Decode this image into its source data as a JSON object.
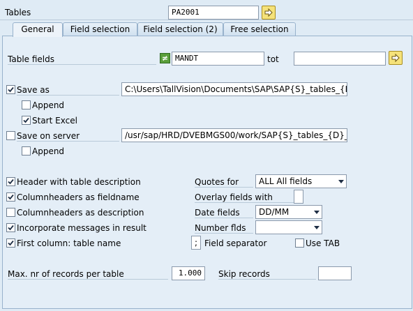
{
  "header": {
    "tables_label": "Tables",
    "tables_value": "PA2001"
  },
  "tabs": [
    {
      "label": "General"
    },
    {
      "label": "Field selection"
    },
    {
      "label": "Field selection (2)"
    },
    {
      "label": "Free selection"
    }
  ],
  "active_tab": "General",
  "general": {
    "table_fields_label": "Table fields",
    "table_fields_value": "MANDT",
    "tot_label": "tot",
    "tot_value": "",
    "save_as": {
      "label": "Save as",
      "checked": true,
      "path": "C:\\Users\\TallVision\\Documents\\SAP\\SAP{S}_tables_{D}..."
    },
    "append_1": {
      "label": "Append",
      "checked": false
    },
    "start_excel": {
      "label": "Start Excel",
      "checked": true
    },
    "save_on_server": {
      "label": "Save on server",
      "checked": false,
      "path": "/usr/sap/HRD/DVEBMGS00/work/SAP{S}_tables_{D}_{..."
    },
    "append_2": {
      "label": "Append",
      "checked": false
    },
    "header_desc": {
      "label": "Header with table description",
      "checked": true
    },
    "colheaders_fieldname": {
      "label": "Columnheaders as fieldname",
      "checked": true
    },
    "colheaders_desc": {
      "label": "Columnheaders as description",
      "checked": false
    },
    "incorporate_msgs": {
      "label": "Incorporate messages in result",
      "checked": true
    },
    "first_column": {
      "label": "First column: table name",
      "checked": true
    },
    "quotes_for": {
      "label": "Quotes for",
      "value": "ALL All fields"
    },
    "overlay_fields": {
      "label": "Overlay fields with",
      "value": ""
    },
    "date_fields": {
      "label": "Date fields",
      "value": "DD/MM"
    },
    "number_flds": {
      "label": "Number flds",
      "value": ""
    },
    "field_separator": {
      "label": "Field separator",
      "value": ";"
    },
    "use_tab": {
      "label": "Use TAB",
      "checked": false
    },
    "max_records": {
      "label": "Max. nr of records per table",
      "value": "1.000"
    },
    "skip_records": {
      "label": "Skip records",
      "value": ""
    }
  }
}
